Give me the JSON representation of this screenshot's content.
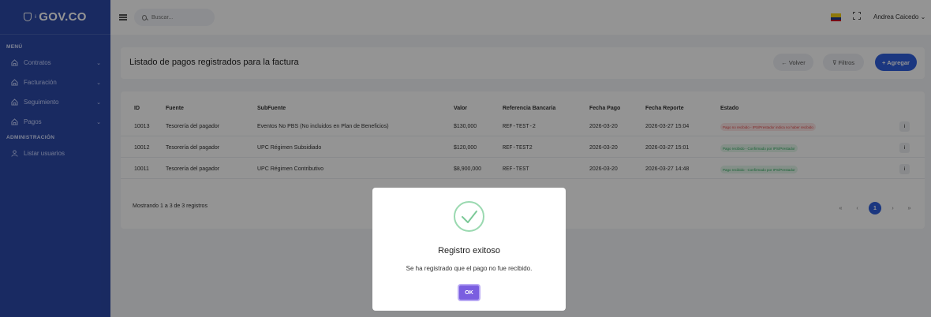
{
  "brand": {
    "name": "GOV.CO",
    "sup": "i"
  },
  "sidebar": {
    "menu_title": "MENÚ",
    "items": [
      {
        "label": "Contratos",
        "chevron": "⌄"
      },
      {
        "label": "Facturación",
        "chevron": "⌄"
      },
      {
        "label": "Seguimiento",
        "chevron": "⌄"
      },
      {
        "label": "Pagos",
        "chevron": "⌄"
      }
    ],
    "admin_title": "ADMINISTRACIÓN",
    "admin_items": [
      {
        "label": "Listar usuarios"
      }
    ]
  },
  "topbar": {
    "search_placeholder": "Buscar...",
    "user_name": "Andrea Caicedo",
    "user_caret": "⌄"
  },
  "page": {
    "title": "Listado de pagos registrados para la factura",
    "back_label": "← Volver",
    "filter_label": "⊽ Filtros",
    "add_label": "+ Agregar"
  },
  "table": {
    "headers": {
      "id": "ID",
      "fuente": "Fuente",
      "subfuente": "SubFuente",
      "valor": "Valor",
      "referencia": "Referencia Bancaria",
      "fecha_pago": "Fecha Pago",
      "fecha_reporte": "Fecha Reporte",
      "estado": "Estado"
    },
    "rows": [
      {
        "id": "10013",
        "fuente": "Tesorería del pagador",
        "subfuente": "Eventos No PBS (No incluidos en Plan de Beneficios)",
        "valor": "$130,000",
        "referencia": "REF-TEST-2",
        "fecha_pago": "2026-03-20",
        "fecha_reporte": "2026-03-27 15:04",
        "estado": "Pago no recibido - IPS/Prestador indica no haber recibido",
        "estado_color": "red",
        "action": "i"
      },
      {
        "id": "10012",
        "fuente": "Tesorería del pagador",
        "subfuente": "UPC Régimen Subsidiado",
        "valor": "$120,000",
        "referencia": "REF-TEST2",
        "fecha_pago": "2026-03-20",
        "fecha_reporte": "2026-03-27 15:01",
        "estado": "Pago recibido - Confirmado por IPS/Prestador",
        "estado_color": "green",
        "action": "i"
      },
      {
        "id": "10011",
        "fuente": "Tesorería del pagador",
        "subfuente": "UPC Régimen Contributivo",
        "valor": "$8,900,000",
        "referencia": "REF-TEST",
        "fecha_pago": "2026-03-20",
        "fecha_reporte": "2026-03-27 14:48",
        "estado": "Pago recibido - Confirmado por IPS/Prestador",
        "estado_color": "green",
        "action": "i"
      }
    ],
    "footer": "Mostrando 1 a 3 de 3 registros"
  },
  "pagination": {
    "first": "«",
    "prev": "‹",
    "current": "1",
    "next": "›",
    "last": "»"
  },
  "modal": {
    "title": "Registro exitoso",
    "message": "Se ha registrado que el pago no fue recibido.",
    "ok_label": "OK"
  },
  "colors": {
    "sidebar": "#2b49a8",
    "primary": "#2f5fdc",
    "ok_button": "#7a5ee0",
    "success": "#2eaa5e",
    "danger": "#e34a4a"
  }
}
